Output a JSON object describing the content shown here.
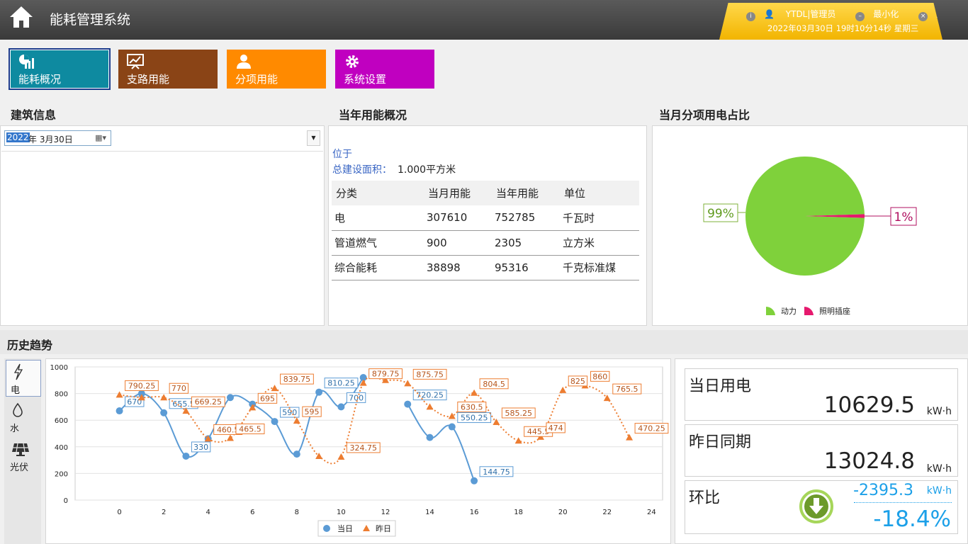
{
  "header": {
    "title": "能耗管理系统",
    "user": "YTDL|管理员",
    "minimize": "最小化",
    "logout": "退出",
    "datetime": "2022年03月30日 19时10分14秒 星期三"
  },
  "nav": [
    {
      "label": "能耗概况",
      "icon": "pie-chart-icon",
      "color": "#0e8aa0"
    },
    {
      "label": "支路用能",
      "icon": "presentation-chart-icon",
      "color": "#8a4416"
    },
    {
      "label": "分项用能",
      "icon": "user-icon",
      "color": "#ff8a00"
    },
    {
      "label": "系统设置",
      "icon": "gear-icon",
      "color": "#c000c0"
    }
  ],
  "building": {
    "title": "建筑信息",
    "date_year": "2022",
    "date_rest": "年  3月30日"
  },
  "overview": {
    "title": "当年用能概况",
    "location_label": "位于",
    "area_label": "总建设面积：",
    "area_value": "1.000平方米",
    "columns": [
      "分类",
      "当月用能",
      "当年用能",
      "单位"
    ],
    "rows": [
      [
        "电",
        "307610",
        "752785",
        "千瓦时"
      ],
      [
        "管道燃气",
        "900",
        "2305",
        "立方米"
      ],
      [
        "综合能耗",
        "38898",
        "95316",
        "千克标准煤"
      ]
    ]
  },
  "pie_panel": {
    "title": "当月分项用电占比",
    "label_big": "99%",
    "label_small": "1%",
    "legend": [
      "动力",
      "照明插座"
    ],
    "colors": [
      "#7fd13b",
      "#e6196e"
    ]
  },
  "history": {
    "title": "历史趋势",
    "side": [
      {
        "label": "电",
        "icon": "lightning-icon"
      },
      {
        "label": "水",
        "icon": "water-drop-icon"
      },
      {
        "label": "光伏",
        "icon": "solar-panel-icon"
      }
    ]
  },
  "chart_data": [
    {
      "type": "pie",
      "labels": [
        "动力",
        "照明插座"
      ],
      "values": [
        99,
        1
      ],
      "data_labels": [
        "99%",
        "1%"
      ],
      "colors": [
        "#7fd13b",
        "#e6196e"
      ],
      "legend_position": "bottom"
    },
    {
      "type": "line",
      "x": [
        0,
        1,
        2,
        3,
        4,
        5,
        6,
        7,
        8,
        9,
        10,
        11,
        12,
        13,
        14,
        15,
        16,
        17,
        18,
        19,
        20,
        21,
        22,
        23
      ],
      "xlim": [
        -2,
        24.5
      ],
      "ylim": [
        0,
        1000
      ],
      "xticks": [
        0,
        2,
        4,
        6,
        8,
        10,
        12,
        14,
        16,
        18,
        20,
        22,
        24
      ],
      "yticks": [
        0,
        200,
        400,
        600,
        800,
        1000
      ],
      "grid": true,
      "legend_position": "bottom",
      "series": [
        {
          "name": "当日",
          "color": "#5b9bd5",
          "values": [
            670,
            800,
            655.5,
            330,
            460.5,
            770,
            720,
            590,
            345,
            810.25,
            700,
            920,
            null,
            720.25,
            470,
            550.25,
            144.75
          ],
          "labels": [
            "670",
            null,
            "655.5",
            "330",
            null,
            null,
            null,
            "590",
            null,
            "810.25",
            "700",
            null,
            null,
            "720.25",
            null,
            "550.25",
            "144.75"
          ]
        },
        {
          "name": "昨日",
          "color": "#ed7d31",
          "values": [
            790.25,
            770,
            770,
            669.25,
            460.5,
            465.5,
            695,
            839.75,
            595,
            330,
            324.75,
            879.75,
            900,
            875.75,
            700,
            630.5,
            804.5,
            585.25,
            445.5,
            474,
            825,
            860,
            765.5,
            470.25
          ],
          "labels": [
            "790.25",
            null,
            "770",
            "669.25",
            "460.5",
            "465.5",
            "695",
            "839.75",
            "595",
            null,
            "324.75",
            "879.75",
            null,
            "875.75",
            null,
            "630.5",
            "804.5",
            "585.25",
            "445.5",
            "474",
            "825",
            "860",
            "765.5",
            "470.25"
          ]
        }
      ]
    }
  ],
  "stats": {
    "today_label": "当日用电",
    "today_value": "10629.5",
    "yesterday_label": "昨日同期",
    "yesterday_value": "13024.8",
    "unit": "kW·h",
    "ratio_label": "环比",
    "ratio_diff": "-2395.3",
    "ratio_pct": "-18.4%"
  }
}
